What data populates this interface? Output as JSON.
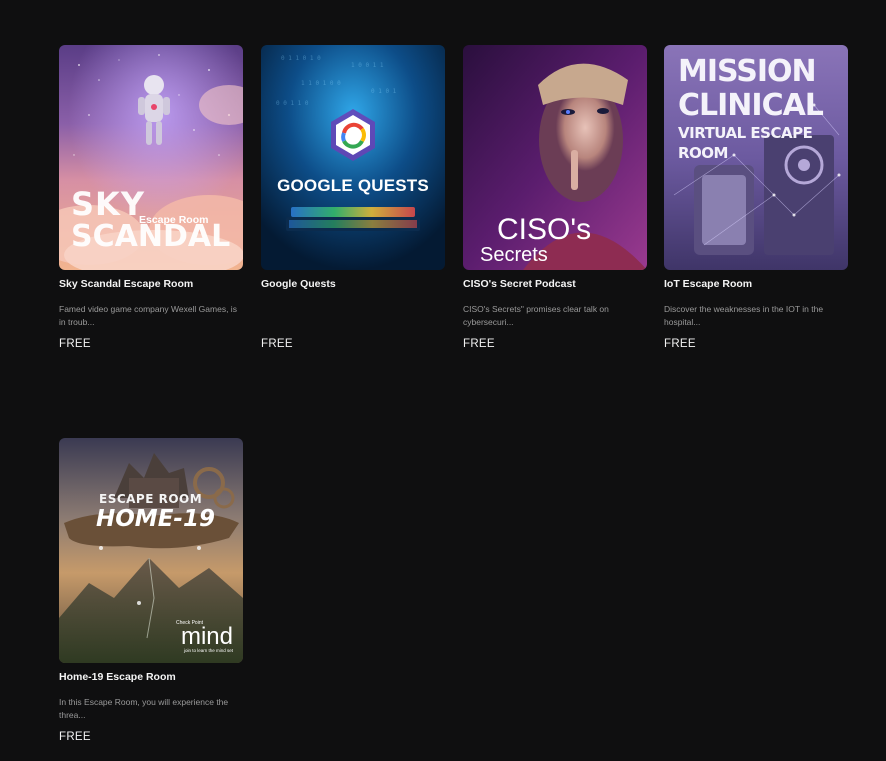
{
  "catalog": {
    "items": [
      {
        "title": "Sky Scandal Escape Room",
        "description": "Famed video game company Wexell Games, is in troub...",
        "price": "FREE",
        "cover": {
          "line1": "SKY",
          "line2": "SCANDAL",
          "tag": "Escape Room"
        }
      },
      {
        "title": "Google Quests",
        "description": "",
        "price": "FREE",
        "cover": {
          "line1": "GOOGLE QUESTS"
        }
      },
      {
        "title": "CISO's Secret Podcast",
        "description": "CISO's Secrets\" promises clear talk on cybersecuri...",
        "price": "FREE",
        "cover": {
          "line1": "CISO's",
          "line2": "Secrets"
        }
      },
      {
        "title": "IoT Escape Room",
        "description": "Discover the weaknesses in the IOT in the hospital...",
        "price": "FREE",
        "cover": {
          "line1": "MISSION",
          "line2": "CLINICAL",
          "line3": "VIRTUAL ESCAPE",
          "line4": "ROOM"
        }
      },
      {
        "title": "Home-19 Escape Room",
        "description": "In this Escape Room, you will experience the threa...",
        "price": "FREE",
        "cover": {
          "line1": "ESCAPE ROOM",
          "line2": "HOME-19",
          "brand": "mind",
          "brand_sub": "Check Point",
          "brand_tag": "join to learn the mind set"
        }
      }
    ]
  },
  "colors": {
    "background": "#0f0f10",
    "title": "#f4f4f4",
    "description": "#9a9a9a"
  }
}
